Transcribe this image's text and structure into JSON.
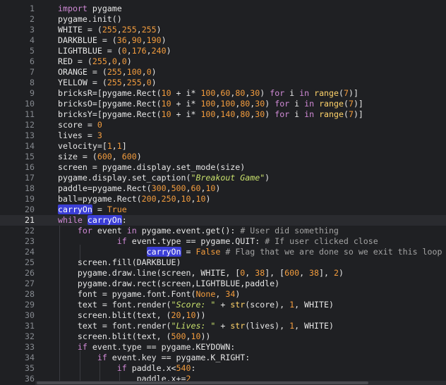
{
  "editor": {
    "current_line": "21",
    "lines": [
      {
        "n": "1",
        "tokens": [
          [
            "kw",
            "import"
          ],
          [
            "t",
            " pygame"
          ]
        ]
      },
      {
        "n": "2",
        "tokens": [
          [
            "t",
            "pygame.init()"
          ]
        ]
      },
      {
        "n": "3",
        "tokens": [
          [
            "t",
            "WHITE = ("
          ],
          [
            "num",
            "255"
          ],
          [
            "t",
            ","
          ],
          [
            "num",
            "255"
          ],
          [
            "t",
            ","
          ],
          [
            "num",
            "255"
          ],
          [
            "t",
            ")"
          ]
        ]
      },
      {
        "n": "4",
        "tokens": [
          [
            "t",
            "DARKBLUE = ("
          ],
          [
            "num",
            "36"
          ],
          [
            "t",
            ","
          ],
          [
            "num",
            "90"
          ],
          [
            "t",
            ","
          ],
          [
            "num",
            "190"
          ],
          [
            "t",
            ")"
          ]
        ]
      },
      {
        "n": "5",
        "tokens": [
          [
            "t",
            "LIGHTBLUE = ("
          ],
          [
            "num",
            "0"
          ],
          [
            "t",
            ","
          ],
          [
            "num",
            "176"
          ],
          [
            "t",
            ","
          ],
          [
            "num",
            "240"
          ],
          [
            "t",
            ")"
          ]
        ]
      },
      {
        "n": "6",
        "tokens": [
          [
            "t",
            "RED = ("
          ],
          [
            "num",
            "255"
          ],
          [
            "t",
            ","
          ],
          [
            "num",
            "0"
          ],
          [
            "t",
            ","
          ],
          [
            "num",
            "0"
          ],
          [
            "t",
            ")"
          ]
        ]
      },
      {
        "n": "7",
        "tokens": [
          [
            "t",
            "ORANGE = ("
          ],
          [
            "num",
            "255"
          ],
          [
            "t",
            ","
          ],
          [
            "num",
            "100"
          ],
          [
            "t",
            ","
          ],
          [
            "num",
            "0"
          ],
          [
            "t",
            ")"
          ]
        ]
      },
      {
        "n": "8",
        "tokens": [
          [
            "t",
            "YELLOW = ("
          ],
          [
            "num",
            "255"
          ],
          [
            "t",
            ","
          ],
          [
            "num",
            "255"
          ],
          [
            "t",
            ","
          ],
          [
            "num",
            "0"
          ],
          [
            "t",
            ")"
          ]
        ]
      },
      {
        "n": "9",
        "tokens": [
          [
            "t",
            "bricksR=[pygame.Rect("
          ],
          [
            "num",
            "10"
          ],
          [
            "t",
            " + i* "
          ],
          [
            "num",
            "100"
          ],
          [
            "t",
            ","
          ],
          [
            "num",
            "60"
          ],
          [
            "t",
            ","
          ],
          [
            "num",
            "80"
          ],
          [
            "t",
            ","
          ],
          [
            "num",
            "30"
          ],
          [
            "t",
            ") "
          ],
          [
            "kw",
            "for"
          ],
          [
            "t",
            " i "
          ],
          [
            "kw",
            "in"
          ],
          [
            "t",
            " "
          ],
          [
            "bi",
            "range"
          ],
          [
            "t",
            "("
          ],
          [
            "num",
            "7"
          ],
          [
            "t",
            ")]"
          ]
        ]
      },
      {
        "n": "10",
        "tokens": [
          [
            "t",
            "bricksO=[pygame.Rect("
          ],
          [
            "num",
            "10"
          ],
          [
            "t",
            " + i* "
          ],
          [
            "num",
            "100"
          ],
          [
            "t",
            ","
          ],
          [
            "num",
            "100"
          ],
          [
            "t",
            ","
          ],
          [
            "num",
            "80"
          ],
          [
            "t",
            ","
          ],
          [
            "num",
            "30"
          ],
          [
            "t",
            ") "
          ],
          [
            "kw",
            "for"
          ],
          [
            "t",
            " i "
          ],
          [
            "kw",
            "in"
          ],
          [
            "t",
            " "
          ],
          [
            "bi",
            "range"
          ],
          [
            "t",
            "("
          ],
          [
            "num",
            "7"
          ],
          [
            "t",
            ")]"
          ]
        ]
      },
      {
        "n": "11",
        "tokens": [
          [
            "t",
            "bricksY=[pygame.Rect("
          ],
          [
            "num",
            "10"
          ],
          [
            "t",
            " + i* "
          ],
          [
            "num",
            "100"
          ],
          [
            "t",
            ","
          ],
          [
            "num",
            "140"
          ],
          [
            "t",
            ","
          ],
          [
            "num",
            "80"
          ],
          [
            "t",
            ","
          ],
          [
            "num",
            "30"
          ],
          [
            "t",
            ") "
          ],
          [
            "kw",
            "for"
          ],
          [
            "t",
            " i "
          ],
          [
            "kw",
            "in"
          ],
          [
            "t",
            " "
          ],
          [
            "bi",
            "range"
          ],
          [
            "t",
            "("
          ],
          [
            "num",
            "7"
          ],
          [
            "t",
            ")]"
          ]
        ]
      },
      {
        "n": "12",
        "tokens": [
          [
            "t",
            "score = "
          ],
          [
            "num",
            "0"
          ]
        ]
      },
      {
        "n": "13",
        "tokens": [
          [
            "t",
            "lives = "
          ],
          [
            "num",
            "3"
          ]
        ]
      },
      {
        "n": "14",
        "tokens": [
          [
            "t",
            "velocity=["
          ],
          [
            "num",
            "1"
          ],
          [
            "t",
            ","
          ],
          [
            "num",
            "1"
          ],
          [
            "t",
            "]"
          ]
        ]
      },
      {
        "n": "15",
        "tokens": [
          [
            "t",
            "size = ("
          ],
          [
            "num",
            "600"
          ],
          [
            "t",
            ", "
          ],
          [
            "num",
            "600"
          ],
          [
            "t",
            ")"
          ]
        ]
      },
      {
        "n": "16",
        "tokens": [
          [
            "t",
            "screen = pygame.display.set_mode(size)"
          ]
        ]
      },
      {
        "n": "17",
        "tokens": [
          [
            "t",
            "pygame.display.set_caption("
          ],
          [
            "str",
            "\"Breakout Game\""
          ],
          [
            "t",
            ")"
          ]
        ]
      },
      {
        "n": "18",
        "tokens": [
          [
            "t",
            "paddle=pygame.Rect("
          ],
          [
            "num",
            "300"
          ],
          [
            "t",
            ","
          ],
          [
            "num",
            "500"
          ],
          [
            "t",
            ","
          ],
          [
            "num",
            "60"
          ],
          [
            "t",
            ","
          ],
          [
            "num",
            "10"
          ],
          [
            "t",
            ")"
          ]
        ]
      },
      {
        "n": "19",
        "tokens": [
          [
            "t",
            "ball=pygame.Rect("
          ],
          [
            "num",
            "200"
          ],
          [
            "t",
            ","
          ],
          [
            "num",
            "250"
          ],
          [
            "t",
            ","
          ],
          [
            "num",
            "10"
          ],
          [
            "t",
            ","
          ],
          [
            "num",
            "10"
          ],
          [
            "t",
            ")"
          ]
        ]
      },
      {
        "n": "20",
        "tokens": [
          [
            "hl",
            "carryOn"
          ],
          [
            "t",
            " = "
          ],
          [
            "num",
            "True"
          ]
        ]
      },
      {
        "n": "21",
        "tokens": [
          [
            "kw",
            "while"
          ],
          [
            "t",
            " "
          ],
          [
            "hl",
            "carryOn"
          ],
          [
            "t",
            ":"
          ]
        ]
      },
      {
        "n": "22",
        "tokens": [
          [
            "t",
            "    "
          ],
          [
            "kw",
            "for"
          ],
          [
            "t",
            " event "
          ],
          [
            "kw",
            "in"
          ],
          [
            "t",
            " pygame.event.get(): "
          ],
          [
            "cmt",
            "# User did something"
          ]
        ]
      },
      {
        "n": "23",
        "tokens": [
          [
            "t",
            "            "
          ],
          [
            "kw",
            "if"
          ],
          [
            "t",
            " event.type == pygame.QUIT: "
          ],
          [
            "cmt",
            "# If user clicked close"
          ]
        ]
      },
      {
        "n": "24",
        "tokens": [
          [
            "t",
            "                  "
          ],
          [
            "hl",
            "carryOn"
          ],
          [
            "t",
            " = "
          ],
          [
            "num",
            "False"
          ],
          [
            "t",
            " "
          ],
          [
            "cmt",
            "# Flag that we are done so we exit this loop"
          ]
        ]
      },
      {
        "n": "25",
        "tokens": [
          [
            "t",
            "    screen.fill(DARKBLUE)"
          ]
        ]
      },
      {
        "n": "26",
        "tokens": [
          [
            "t",
            "    pygame.draw.line(screen, WHITE, ["
          ],
          [
            "num",
            "0"
          ],
          [
            "t",
            ", "
          ],
          [
            "num",
            "38"
          ],
          [
            "t",
            "], ["
          ],
          [
            "num",
            "600"
          ],
          [
            "t",
            ", "
          ],
          [
            "num",
            "38"
          ],
          [
            "t",
            "], "
          ],
          [
            "num",
            "2"
          ],
          [
            "t",
            ")"
          ]
        ]
      },
      {
        "n": "27",
        "tokens": [
          [
            "t",
            "    pygame.draw.rect(screen,LIGHTBLUE,paddle)"
          ]
        ]
      },
      {
        "n": "28",
        "tokens": [
          [
            "t",
            "    font = pygame.font.Font("
          ],
          [
            "num",
            "None"
          ],
          [
            "t",
            ", "
          ],
          [
            "num",
            "34"
          ],
          [
            "t",
            ")"
          ]
        ]
      },
      {
        "n": "29",
        "tokens": [
          [
            "t",
            "    text = font.render("
          ],
          [
            "str",
            "\"Score: \""
          ],
          [
            "t",
            " + "
          ],
          [
            "bi",
            "str"
          ],
          [
            "t",
            "(score), "
          ],
          [
            "num",
            "1"
          ],
          [
            "t",
            ", WHITE)"
          ]
        ]
      },
      {
        "n": "30",
        "tokens": [
          [
            "t",
            "    screen.blit(text, ("
          ],
          [
            "num",
            "20"
          ],
          [
            "t",
            ","
          ],
          [
            "num",
            "10"
          ],
          [
            "t",
            "))"
          ]
        ]
      },
      {
        "n": "31",
        "tokens": [
          [
            "t",
            "    text = font.render("
          ],
          [
            "str",
            "\"Lives: \""
          ],
          [
            "t",
            " + "
          ],
          [
            "bi",
            "str"
          ],
          [
            "t",
            "(lives), "
          ],
          [
            "num",
            "1"
          ],
          [
            "t",
            ", WHITE)"
          ]
        ]
      },
      {
        "n": "32",
        "tokens": [
          [
            "t",
            "    screen.blit(text, ("
          ],
          [
            "num",
            "500"
          ],
          [
            "t",
            ","
          ],
          [
            "num",
            "10"
          ],
          [
            "t",
            "))"
          ]
        ]
      },
      {
        "n": "33",
        "tokens": [
          [
            "t",
            "    "
          ],
          [
            "kw",
            "if"
          ],
          [
            "t",
            " event.type == pygame.KEYDOWN:"
          ]
        ]
      },
      {
        "n": "34",
        "tokens": [
          [
            "t",
            "        "
          ],
          [
            "kw",
            "if"
          ],
          [
            "t",
            " event.key == pygame.K_RIGHT:"
          ]
        ]
      },
      {
        "n": "35",
        "tokens": [
          [
            "t",
            "            "
          ],
          [
            "kw",
            "if"
          ],
          [
            "t",
            " paddle.x<"
          ],
          [
            "num",
            "540"
          ],
          [
            "t",
            ":"
          ]
        ]
      },
      {
        "n": "36",
        "tokens": [
          [
            "t",
            "                paddle.x+="
          ],
          [
            "num",
            "2"
          ]
        ]
      }
    ]
  }
}
